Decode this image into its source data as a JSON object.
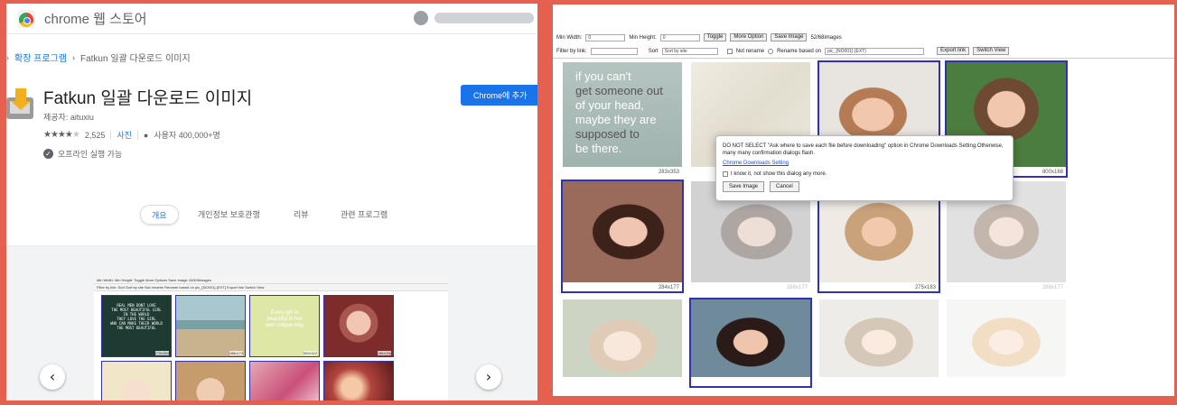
{
  "store": {
    "title": "chrome 웹 스토어",
    "breadcrumb": {
      "link": "확장 프로그램",
      "sep": "›",
      "current": "Fatkun 일괄 다운로드 이미지"
    },
    "extension": {
      "name": "Fatkun 일괄 다운로드 이미지",
      "provider": "제공자: aituxiu",
      "rating_stars": "★★★★",
      "rating_star_off": "★",
      "rating_count": "2,525",
      "photos_link": "사진",
      "users": "사용자 400,000+명",
      "offline": "오프라인 실행 가능"
    },
    "add_button": "Chrome에 추가",
    "tabs": [
      "개요",
      "개인정보 보호관행",
      "리뷰",
      "관련 프로그램"
    ],
    "carousel": {
      "prev": "‹",
      "next": "›",
      "mini_toolbar_1": "Min Width:    Min Height:    Toggle  More Options  Save Image  43/406images",
      "mini_toolbar_2": "Filter by link:        Sort  Sort by site    Not rename  Rename based on  pic_{NO001}.{EXT}   Export link  Switch View",
      "mini_quote": "REAL MEN DONT LOVE\nTHE MOST BEAUTIFUL GIRL\nIN THE WORLD\nTHEY LOVE THE GIRL\nWHO CAN MAKE THEIR WORLD\nTHE MOST BEAUTIFUL",
      "mini_quote2": "Every girl is\nbeautiful in her\nown unique way",
      "mini_sizes": [
        "275x353",
        "288x173",
        "500x322",
        "288x288"
      ]
    }
  },
  "fatkun": {
    "toolbar1": {
      "min_width_label": "Min Width:",
      "min_width_value": "0",
      "min_height_label": "Min Height:",
      "min_height_value": "0",
      "toggle": "Toggle",
      "more_options": "More Option",
      "save_image": "Save Image",
      "count": "52/68images"
    },
    "toolbar2": {
      "filter_label": "Filter by link:",
      "sort_label": "Sort",
      "sort_value": "Sort by site",
      "not_rename": "Not rename",
      "rename_based": "Rename based on",
      "pattern": "pic_{NO001}.{EXT}",
      "export_link": "Export link",
      "switch_view": "Switch View"
    },
    "poster": {
      "line1": "if you can't",
      "line2": "get someone out",
      "line3": "of your head,",
      "line4": "maybe they are",
      "line5": "supposed to",
      "line6": "be there.",
      "size": "283x353"
    },
    "sizes": [
      "800x168",
      "284x177",
      "288x177",
      "275x183",
      "288x177"
    ],
    "dialog": {
      "message": "DO NOT SELECT \"Ask where to save each file before downloading\" option in Chrome Downloads Setting.Otherwise, many many confirmation dialogs flash.",
      "link": "Chrome Downloads Setting",
      "checkbox_label": "I know it, not show this dialog any more.",
      "save_button": "Save Image",
      "cancel_button": "Cancel"
    }
  }
}
